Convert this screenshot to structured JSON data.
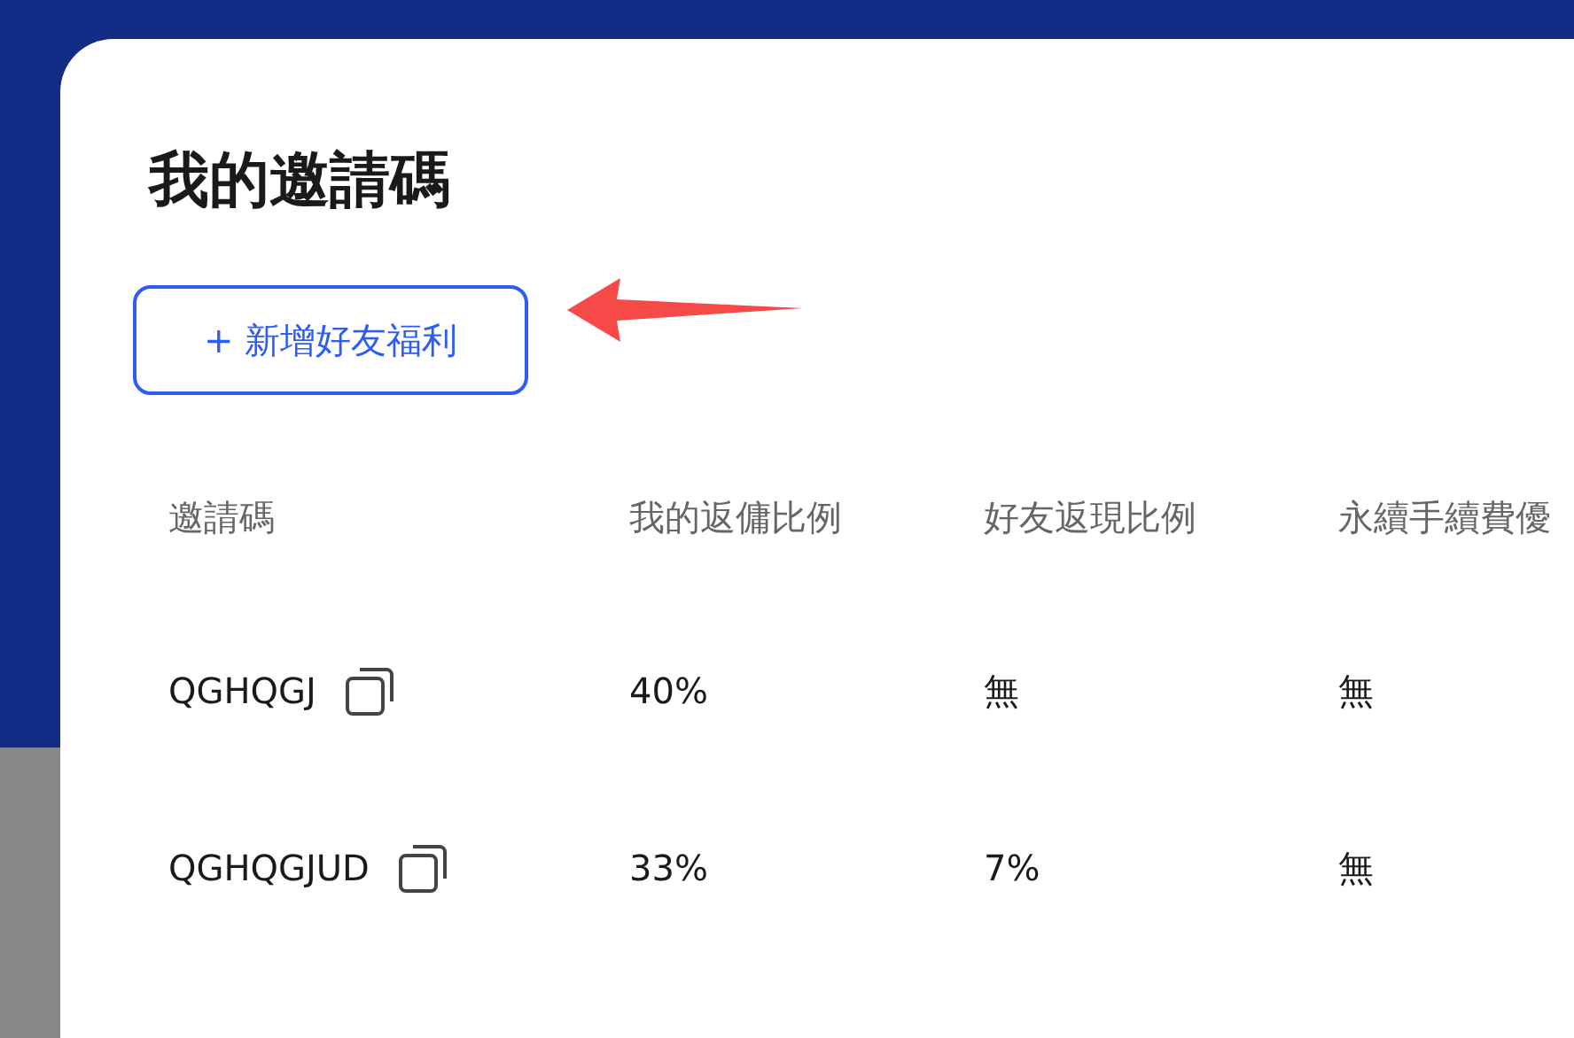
{
  "dialog": {
    "title": "我的邀請碼",
    "add_button": {
      "icon": "+",
      "label": "新增好友福利"
    }
  },
  "table": {
    "columns": [
      "邀請碼",
      "我的返傭比例",
      "好友返現比例",
      "永續手續費優"
    ],
    "rows": [
      {
        "cells": [
          "QGHQGJ",
          "40%",
          "無",
          "無"
        ]
      },
      {
        "cells": [
          "QGHQGJUD",
          "33%",
          "7%",
          "無"
        ]
      }
    ]
  }
}
